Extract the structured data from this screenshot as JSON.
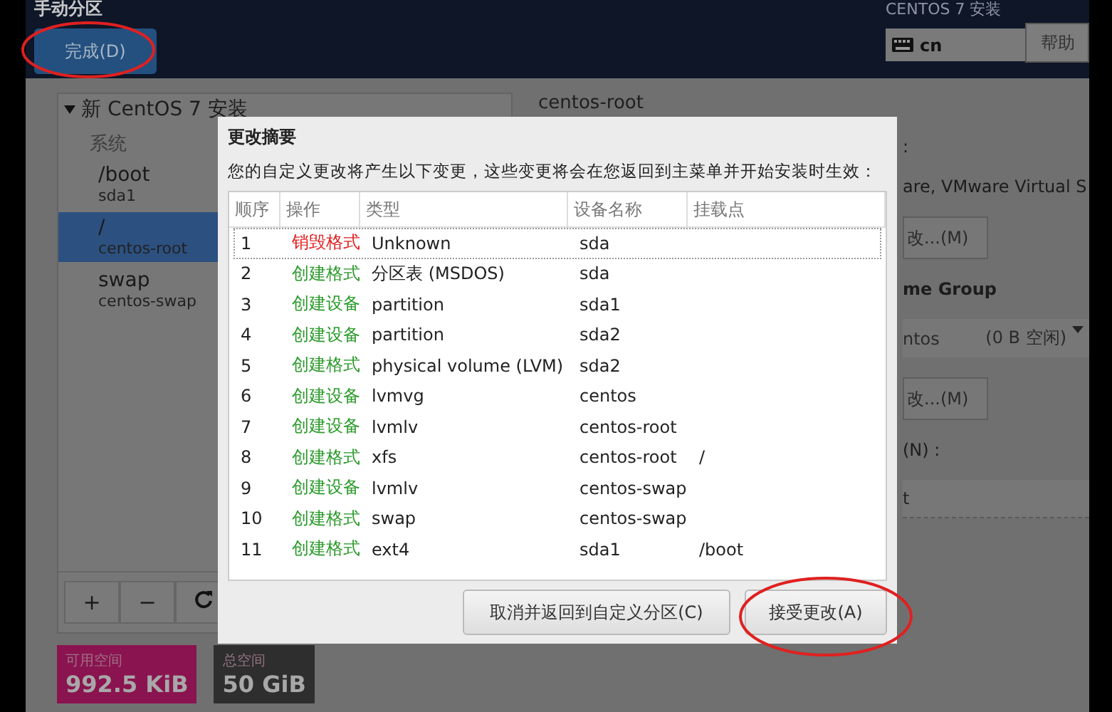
{
  "header": {
    "title": "手动分区",
    "done_button": "完成(D)",
    "product": "CENTOS 7 安装",
    "keyboard": "cn",
    "help_button": "帮助"
  },
  "left_panel": {
    "install_title": "新 CentOS 7 安装",
    "expanded": true,
    "group": "系统",
    "mounts": [
      {
        "path": "/boot",
        "device": "sda1",
        "selected": false
      },
      {
        "path": "/",
        "device": "centos-root",
        "selected": true
      },
      {
        "path": "swap",
        "device": "centos-swap",
        "selected": false
      }
    ],
    "toolbar": [
      "+",
      "−"
    ],
    "space": [
      {
        "label": "可用空间",
        "value": "992.5 KiB",
        "color": "#8a1450"
      },
      {
        "label": "总空间",
        "value": "50 GiB",
        "color": "#2e2e2e"
      }
    ]
  },
  "right_panel": {
    "heading": "centos-root",
    "fragments": [
      {
        "kind": "text",
        "text": ":"
      },
      {
        "kind": "text",
        "text": "are, VMware Virtual S"
      },
      {
        "kind": "button",
        "text": "改...(M)"
      },
      {
        "kind": "label",
        "text": "me Group"
      },
      {
        "kind": "dropdown",
        "text": "ntos",
        "hint": "(0 B 空闲)"
      },
      {
        "kind": "button",
        "text": "改...(M)"
      },
      {
        "kind": "text",
        "text": "(N) :"
      },
      {
        "kind": "field",
        "text": "t"
      }
    ]
  },
  "dialog": {
    "title": "更改摘要",
    "description": "您的自定义更改将产生以下变更，这些变更将会在您返回到主菜单并开始安装时生效：",
    "columns": [
      "顺序",
      "操作",
      "类型",
      "设备名称",
      "挂载点"
    ],
    "rows": [
      {
        "order": "1",
        "action": "销毁格式",
        "kind": "destroy",
        "type": "Unknown",
        "device": "sda",
        "mount": "",
        "selected": true
      },
      {
        "order": "2",
        "action": "创建格式",
        "kind": "create",
        "type": "分区表 (MSDOS)",
        "device": "sda",
        "mount": "",
        "selected": false
      },
      {
        "order": "3",
        "action": "创建设备",
        "kind": "create",
        "type": "partition",
        "device": "sda1",
        "mount": "",
        "selected": false
      },
      {
        "order": "4",
        "action": "创建设备",
        "kind": "create",
        "type": "partition",
        "device": "sda2",
        "mount": "",
        "selected": false
      },
      {
        "order": "5",
        "action": "创建格式",
        "kind": "create",
        "type": "physical volume (LVM)",
        "device": "sda2",
        "mount": "",
        "selected": false
      },
      {
        "order": "6",
        "action": "创建设备",
        "kind": "create",
        "type": "lvmvg",
        "device": "centos",
        "mount": "",
        "selected": false
      },
      {
        "order": "7",
        "action": "创建设备",
        "kind": "create",
        "type": "lvmlv",
        "device": "centos-root",
        "mount": "",
        "selected": false
      },
      {
        "order": "8",
        "action": "创建格式",
        "kind": "create",
        "type": "xfs",
        "device": "centos-root",
        "mount": "/",
        "selected": false
      },
      {
        "order": "9",
        "action": "创建设备",
        "kind": "create",
        "type": "lvmlv",
        "device": "centos-swap",
        "mount": "",
        "selected": false
      },
      {
        "order": "10",
        "action": "创建格式",
        "kind": "create",
        "type": "swap",
        "device": "centos-swap",
        "mount": "",
        "selected": false
      },
      {
        "order": "11",
        "action": "创建格式",
        "kind": "create",
        "type": "ext4",
        "device": "sda1",
        "mount": "/boot",
        "selected": false
      }
    ],
    "buttons": [
      "取消并返回到自定义分区(C)",
      "接受更改(A)"
    ]
  }
}
